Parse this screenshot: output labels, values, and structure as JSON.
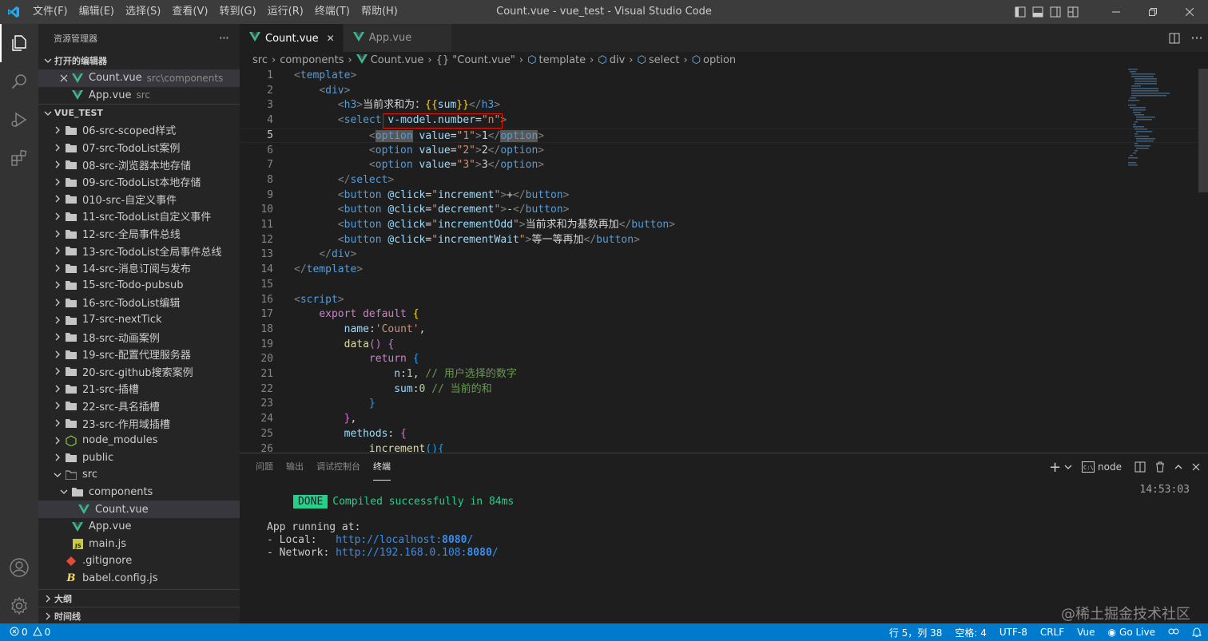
{
  "titlebar": {
    "title": "Count.vue - vue_test - Visual Studio Code",
    "menu": [
      "文件(F)",
      "编辑(E)",
      "选择(S)",
      "查看(V)",
      "转到(G)",
      "运行(R)",
      "终端(T)",
      "帮助(H)"
    ]
  },
  "sidebar": {
    "header": "资源管理器",
    "more": "···",
    "open_editors_title": "打开的编辑器",
    "open_editors": [
      {
        "name": "Count.vue",
        "desc": "src\\components"
      },
      {
        "name": "App.vue",
        "desc": "src"
      }
    ],
    "project_title": "VUE_TEST",
    "folders": [
      "06-src-scoped样式",
      "07-src-TodoList案例",
      "08-src-浏览器本地存储",
      "09-src-TodoList本地存储",
      "010-src-自定义事件",
      "11-src-TodoList自定义事件",
      "12-src-全局事件总线",
      "13-src-TodoList全局事件总线",
      "14-src-消息订阅与发布",
      "15-src-Todo-pubsub",
      "16-src-TodoList编辑",
      "17-src-nextTick",
      "18-src-动画案例",
      "19-src-配置代理服务器",
      "20-src-github搜索案例",
      "21-src-插槽",
      "22-src-具名插槽",
      "23-src-作用域插槽",
      "node_modules",
      "public"
    ],
    "src_folder": "src",
    "components_folder": "components",
    "count_file": "Count.vue",
    "app_file": "App.vue",
    "main_file": "main.js",
    "gitignore_file": ".gitignore",
    "babel_file": "babel.config.js",
    "outline_title": "大纲",
    "timeline_title": "时间线"
  },
  "tabs": [
    {
      "label": "Count.vue",
      "close": "✕"
    },
    {
      "label": "App.vue"
    }
  ],
  "breadcrumb": [
    "src",
    "components",
    "Count.vue",
    "{} \"Count.vue\"",
    "template",
    "div",
    "select",
    "option"
  ],
  "editor": {
    "line_numbers": [
      "1",
      "2",
      "3",
      "4",
      "5",
      "6",
      "7",
      "8",
      "9",
      "10",
      "11",
      "12",
      "13",
      "14",
      "15",
      "16",
      "17",
      "18",
      "19",
      "20",
      "21",
      "22",
      "23",
      "24",
      "25",
      "26"
    ],
    "current_line": 5
  },
  "panel": {
    "tabs": [
      "问题",
      "输出",
      "调试控制台",
      "终端"
    ],
    "active_tab": "终端",
    "terminal_name": "node",
    "done": "DONE",
    "compiled": "Compiled successfully in 84ms",
    "time": "14:53:03",
    "app_running": "App running at:",
    "local_label": "- Local:   ",
    "local_url_prefix": "http://localhost:",
    "local_port": "8080",
    "url_suffix": "/",
    "network_label": "- Network: ",
    "network_url_prefix": "http://192.168.0.108:",
    "network_port": "8080"
  },
  "statusbar": {
    "errors": "0",
    "warnings": "0",
    "position": "行 5，列 38",
    "spaces": "空格: 4",
    "encoding": "UTF-8",
    "eol": "CRLF",
    "language": "Vue",
    "golive": "Go Live"
  },
  "watermark": "@稀土掘金技术社区",
  "colors": {
    "accent": "#007acc",
    "vue_green": "#41b883",
    "highlight_box": "#e51400"
  }
}
